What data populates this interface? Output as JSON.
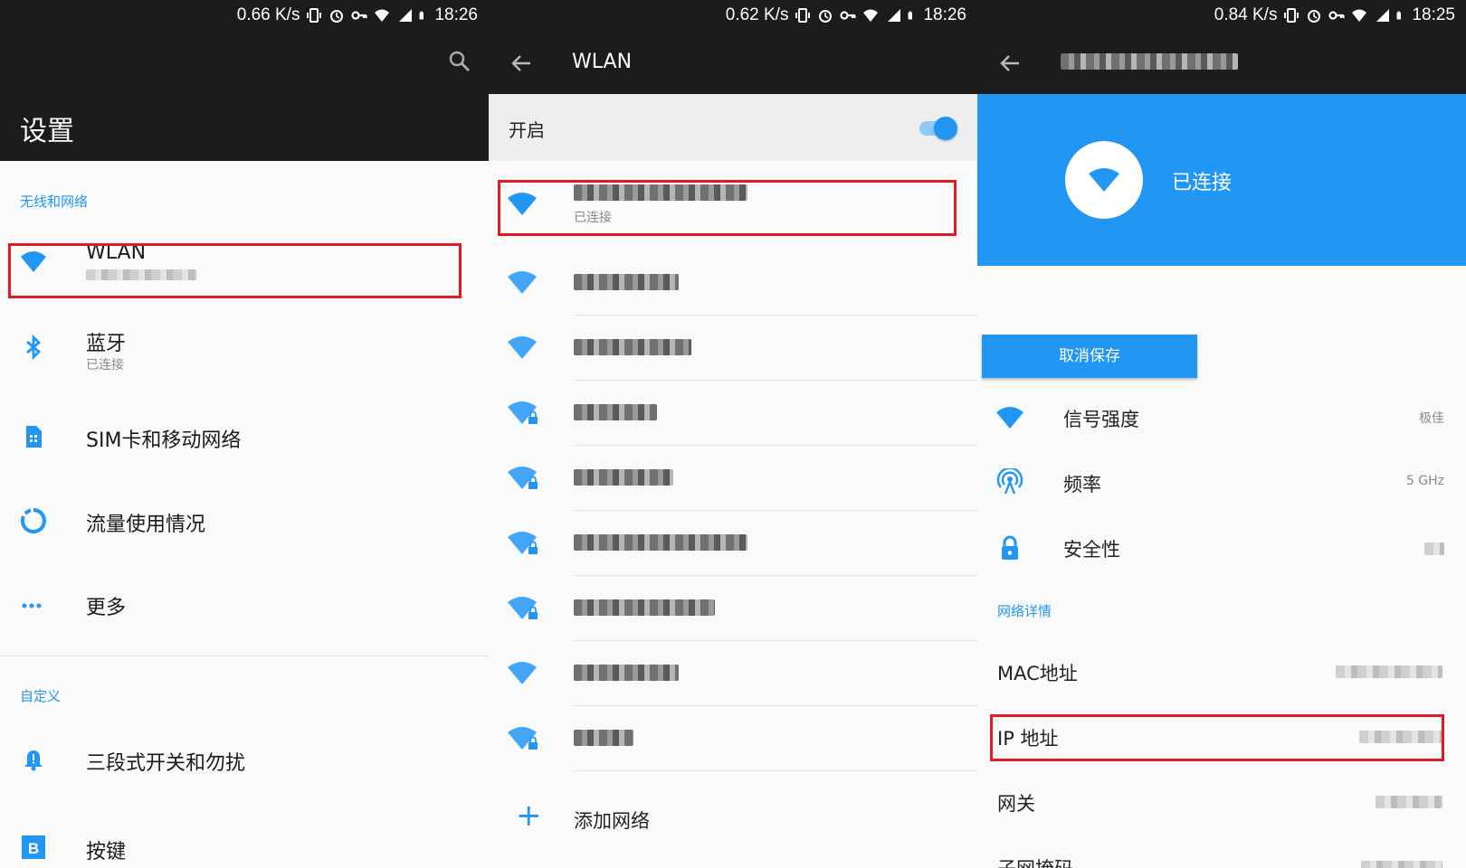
{
  "panel1": {
    "status": {
      "speed": "0.66 K/s",
      "time": "18:26"
    },
    "title": "设置",
    "section_wireless": "无线和网络",
    "items": [
      {
        "label": "WLAN",
        "sub": ""
      },
      {
        "label": "蓝牙",
        "sub": "已连接"
      },
      {
        "label": "SIM卡和移动网络",
        "sub": ""
      },
      {
        "label": "流量使用情况",
        "sub": ""
      },
      {
        "label": "更多",
        "sub": ""
      }
    ],
    "section_custom": "自定义",
    "custom_items": [
      {
        "label": "三段式开关和勿扰"
      },
      {
        "label": "按键"
      }
    ]
  },
  "panel2": {
    "status": {
      "speed": "0.62 K/s",
      "time": "18:26"
    },
    "title": "WLAN",
    "switch_label": "开启",
    "switch_on": true,
    "connected_sub": "已连接",
    "networks": [
      {
        "locked": false,
        "connected": true
      },
      {
        "locked": false
      },
      {
        "locked": false
      },
      {
        "locked": true
      },
      {
        "locked": true
      },
      {
        "locked": true
      },
      {
        "locked": true
      },
      {
        "locked": false
      },
      {
        "locked": true
      }
    ],
    "add_network": "添加网络"
  },
  "panel3": {
    "status": {
      "speed": "0.84 K/s",
      "time": "18:25"
    },
    "status_label": "已连接",
    "forget_button": "取消保存",
    "info": [
      {
        "label": "信号强度",
        "value": "极佳",
        "icon": "wifi-icon"
      },
      {
        "label": "频率",
        "value": "5 GHz",
        "icon": "antenna-icon"
      },
      {
        "label": "安全性",
        "value": "",
        "icon": "lock-icon"
      }
    ],
    "section_details": "网络详情",
    "details": [
      {
        "label": "MAC地址"
      },
      {
        "label": "IP 地址"
      },
      {
        "label": "网关"
      },
      {
        "label": "子网掩码"
      }
    ]
  },
  "colors": {
    "accent": "#2196f3",
    "bar": "#1c1c1c",
    "highlight": "#e01b24"
  }
}
